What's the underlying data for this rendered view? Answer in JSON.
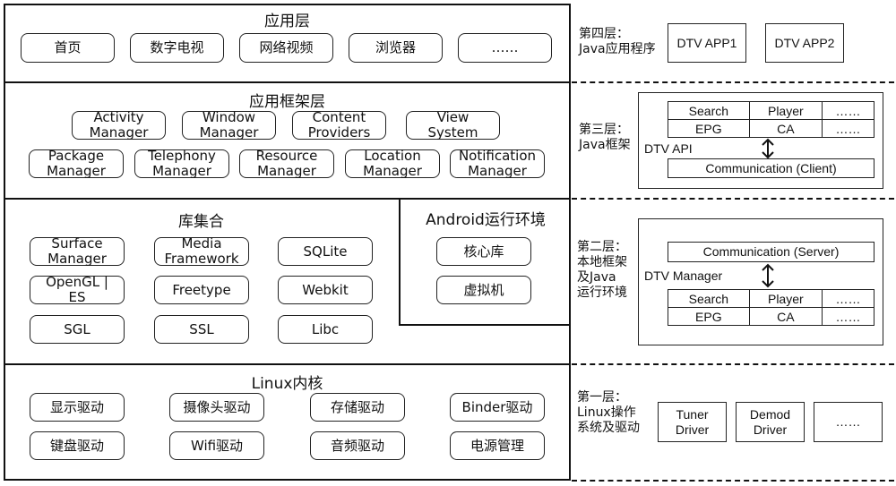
{
  "left": {
    "app_layer": {
      "title": "应用层",
      "items": [
        "首页",
        "数字电视",
        "网络视频",
        "浏览器",
        "……"
      ]
    },
    "framework_layer": {
      "title": "应用框架层",
      "row1": [
        [
          "Activity",
          "Manager"
        ],
        [
          "Window",
          "Manager"
        ],
        [
          "Content",
          "Providers"
        ],
        [
          "View",
          "System"
        ]
      ],
      "row2": [
        [
          "Package",
          "Manager"
        ],
        [
          "Telephony",
          "Manager"
        ],
        [
          "Resource",
          "Manager"
        ],
        [
          "Location",
          "Manager"
        ],
        [
          "Notification",
          "Manager"
        ]
      ]
    },
    "library_layer": {
      "title": "库集合",
      "items": [
        [
          "Surface",
          "Manager"
        ],
        [
          "Media",
          "Framework"
        ],
        [
          "SQLite",
          ""
        ],
        [
          "OpenGL |",
          "ES"
        ],
        [
          "Freetype",
          ""
        ],
        [
          "Webkit",
          ""
        ],
        [
          "SGL",
          ""
        ],
        [
          "SSL",
          ""
        ],
        [
          "Libc",
          ""
        ]
      ]
    },
    "runtime": {
      "title": "Android运行环境",
      "items": [
        "核心库",
        "虚拟机"
      ]
    },
    "kernel_layer": {
      "title": "Linux内核",
      "items": [
        "显示驱动",
        "摄像头驱动",
        "存储驱动",
        "Binder驱动",
        "键盘驱动",
        "Wifi驱动",
        "音频驱动",
        "电源管理"
      ]
    }
  },
  "right": {
    "layer4": {
      "label": "第四层：\nJava应用程序",
      "apps": [
        "DTV APP1",
        "DTV APP2"
      ]
    },
    "layer3": {
      "label": "第三层：\nJava框架",
      "box_caption": "DTV API",
      "table": [
        [
          "Search",
          "Player",
          "……"
        ],
        [
          "EPG",
          "CA",
          "……"
        ]
      ],
      "comm": "Communication (Client)"
    },
    "layer2": {
      "label": "第二层：\n本地框架\n及Java\n运行环境",
      "box_caption": "DTV Manager",
      "comm": "Communication (Server)",
      "table": [
        [
          "Search",
          "Player",
          "……"
        ],
        [
          "EPG",
          "CA",
          "……"
        ]
      ]
    },
    "layer1": {
      "label": "第一层：\nLinux操作\n系统及驱动",
      "drivers": [
        [
          "Tuner",
          "Driver"
        ],
        [
          "Demod",
          "Driver"
        ],
        [
          "……",
          ""
        ]
      ]
    }
  }
}
